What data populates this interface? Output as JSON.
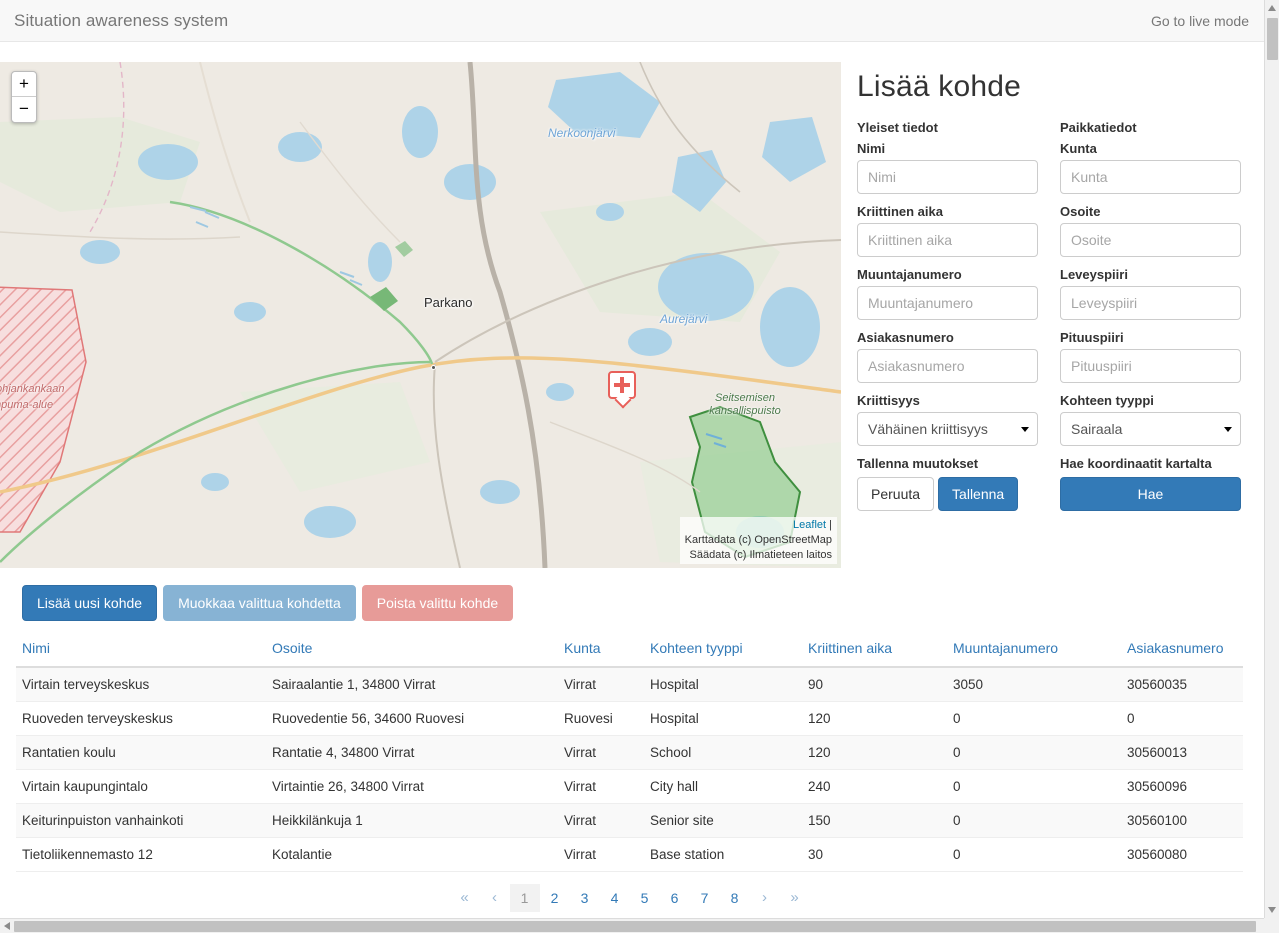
{
  "navbar": {
    "brand": "Situation awareness system",
    "live_mode_link": "Go to live mode"
  },
  "map": {
    "zoom_in": "+",
    "zoom_out": "−",
    "attribution": {
      "leaflet": "Leaflet",
      "separator": "|",
      "line2": "Karttadata (c) OpenStreetMap",
      "line3": "Säädata (c) Ilmatieteen laitos"
    },
    "labels": {
      "lake_north": "Nerkoonjärvi",
      "lake_east": "Aurejärvi",
      "town": "Parkano",
      "park_line1": "Seitsemisen",
      "park_line2": "kansallispuisto",
      "military_line1": "ohjankankaan",
      "military_line2": "mpuma-alue"
    },
    "marker": "hospital-marker"
  },
  "form": {
    "title": "Lisää kohde",
    "left": {
      "section": "Yleiset tiedot",
      "fields": [
        {
          "label": "Nimi",
          "placeholder": "Nimi",
          "value": ""
        },
        {
          "label": "Kriittinen aika",
          "placeholder": "Kriittinen aika",
          "value": ""
        },
        {
          "label": "Muuntajanumero",
          "placeholder": "Muuntajanumero",
          "value": ""
        },
        {
          "label": "Asiakasnumero",
          "placeholder": "Asiakasnumero",
          "value": ""
        }
      ],
      "select": {
        "label": "Kriittisyys",
        "selected": "Vähäinen kriittisyys"
      },
      "save_section": "Tallenna muutokset",
      "cancel_button": "Peruuta",
      "save_button": "Tallenna"
    },
    "right": {
      "section": "Paikkatiedot",
      "fields": [
        {
          "label": "Kunta",
          "placeholder": "Kunta",
          "value": ""
        },
        {
          "label": "Osoite",
          "placeholder": "Osoite",
          "value": ""
        },
        {
          "label": "Leveyspiiri",
          "placeholder": "Leveyspiiri",
          "value": ""
        },
        {
          "label": "Pituuspiiri",
          "placeholder": "Pituuspiiri",
          "value": ""
        }
      ],
      "select": {
        "label": "Kohteen tyyppi",
        "selected": "Sairaala"
      },
      "fetch_section": "Hae koordinaatit kartalta",
      "fetch_button": "Hae"
    }
  },
  "actions": {
    "add": "Lisää uusi kohde",
    "edit": "Muokkaa valittua kohdetta",
    "delete": "Poista valittu kohde"
  },
  "table": {
    "headers": [
      "Nimi",
      "Osoite",
      "Kunta",
      "Kohteen tyyppi",
      "Kriittinen aika",
      "Muuntajanumero",
      "Asiakasnumero"
    ],
    "rows": [
      {
        "nimi": "Virtain terveyskeskus",
        "osoite": "Sairaalantie 1, 34800 Virrat",
        "kunta": "Virrat",
        "tyyppi": "Hospital",
        "kriittinen_aika": "90",
        "muuntajanumero": "3050",
        "asiakasnumero": "30560035"
      },
      {
        "nimi": "Ruoveden terveyskeskus",
        "osoite": "Ruovedentie 56, 34600 Ruovesi",
        "kunta": "Ruovesi",
        "tyyppi": "Hospital",
        "kriittinen_aika": "120",
        "muuntajanumero": "0",
        "asiakasnumero": "0"
      },
      {
        "nimi": "Rantatien koulu",
        "osoite": "Rantatie 4, 34800 Virrat",
        "kunta": "Virrat",
        "tyyppi": "School",
        "kriittinen_aika": "120",
        "muuntajanumero": "0",
        "asiakasnumero": "30560013"
      },
      {
        "nimi": "Virtain kaupungintalo",
        "osoite": "Virtaintie 26, 34800 Virrat",
        "kunta": "Virrat",
        "tyyppi": "City hall",
        "kriittinen_aika": "240",
        "muuntajanumero": "0",
        "asiakasnumero": "30560096"
      },
      {
        "nimi": "Keiturinpuiston vanhainkoti",
        "osoite": "Heikkilänkuja 1",
        "kunta": "Virrat",
        "tyyppi": "Senior site",
        "kriittinen_aika": "150",
        "muuntajanumero": "0",
        "asiakasnumero": "30560100"
      },
      {
        "nimi": "Tietoliikennemasto 12",
        "osoite": "Kotalantie",
        "kunta": "Virrat",
        "tyyppi": "Base station",
        "kriittinen_aika": "30",
        "muuntajanumero": "0",
        "asiakasnumero": "30560080"
      }
    ]
  },
  "pagination": {
    "first": "«",
    "prev": "‹",
    "pages": [
      "1",
      "2",
      "3",
      "4",
      "5",
      "6",
      "7",
      "8"
    ],
    "active": "1",
    "next": "›",
    "last": "»"
  },
  "colors": {
    "primary": "#337ab7",
    "muted_primary": "#87b3d4",
    "danger_soft": "#e79b98",
    "link": "#337ab7",
    "marker_red": "#e8605a"
  }
}
